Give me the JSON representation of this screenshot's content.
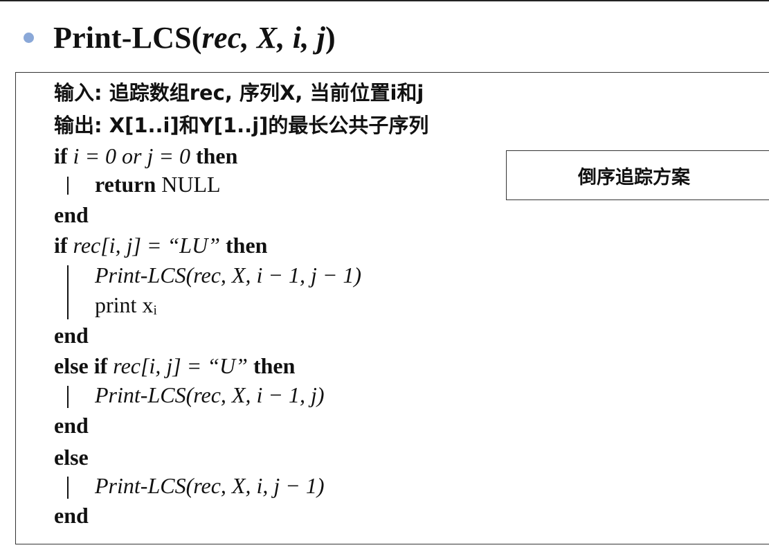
{
  "slide": {
    "title_prefix": "Print-LCS(",
    "title_args": "rec, X, i, j",
    "title_suffix": ")"
  },
  "algorithm": {
    "input_label": "输入:",
    "input_text": " 追踪数组rec, 序列X, 当前位置i和j",
    "output_label": "输出:",
    "output_text": " X[1..i]和Y[1..j]的最长公共子序列",
    "lines": [
      {
        "kw1": "if",
        "expr": " i = 0 or j = 0 ",
        "kw2": "then"
      },
      {
        "kw1": "return",
        "expr": " NULL",
        "kw2": ""
      },
      {
        "kw1": "end",
        "expr": "",
        "kw2": ""
      },
      {
        "kw1": "if",
        "expr": " rec[i, j] = “LU” ",
        "kw2": "then"
      },
      {
        "kw1": "",
        "expr": "Print-LCS(rec, X, i − 1, j − 1)",
        "kw2": ""
      },
      {
        "kw1": "",
        "expr": "print xᵢ",
        "kw2": ""
      },
      {
        "kw1": "end",
        "expr": "",
        "kw2": ""
      },
      {
        "kw1": "else if",
        "expr": " rec[i, j] = “U” ",
        "kw2": "then"
      },
      {
        "kw1": "",
        "expr": "Print-LCS(rec, X, i − 1, j)",
        "kw2": ""
      },
      {
        "kw1": "end",
        "expr": "",
        "kw2": ""
      },
      {
        "kw1": "else",
        "expr": "",
        "kw2": ""
      },
      {
        "kw1": "",
        "expr": "Print-LCS(rec, X, i, j − 1)",
        "kw2": ""
      },
      {
        "kw1": "end",
        "expr": "",
        "kw2": ""
      }
    ]
  },
  "callout": {
    "text": "倒序追踪方案"
  },
  "colors": {
    "bullet": "#8aa8d8",
    "border": "#333333",
    "text": "#111111"
  }
}
